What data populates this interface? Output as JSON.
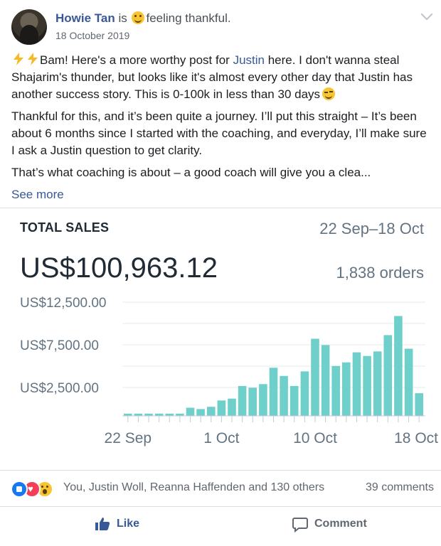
{
  "post": {
    "author": "Howie Tan",
    "status_prefix": " is ",
    "feeling": "feeling thankful.",
    "date": "18 October 2019",
    "para1_a": "Bam! Here's a more worthy post for ",
    "para1_mention": "Justin",
    "para1_b": " here. I don't wanna steal Shajarim's thunder, but looks like it's almost every other day that Justin has another success story. This is 0-100k in less than 30 days",
    "para2": "Thankful for this, and it’s been quite a journey. I’ll put this straight – It’s been about 6 months since I started with the coaching, and everyday, I’ll make sure I ask a Justin question to get clarity.",
    "para3": "That’s what coaching is about – a good coach will give you a clea...",
    "see_more": "See more"
  },
  "sales": {
    "title": "TOTAL SALES",
    "range": "22 Sep–18 Oct",
    "total": "US$100,963.12",
    "orders": "1,838 orders"
  },
  "chart_data": {
    "type": "bar",
    "ylim": [
      0,
      13000
    ],
    "yticks": [
      12500,
      7500,
      2500
    ],
    "ytick_labels": [
      "US$12,500.00",
      "US$7,500.00",
      "US$2,500.00"
    ],
    "grid_values": [
      12500,
      10000,
      7500,
      5000,
      2500
    ],
    "x_tick_labels": [
      {
        "index": 0,
        "label": "22 Sep"
      },
      {
        "index": 9,
        "label": "1 Oct"
      },
      {
        "index": 18,
        "label": "10 Oct"
      },
      {
        "index": 26,
        "label": "18 Oct"
      }
    ],
    "values": [
      250,
      250,
      250,
      250,
      250,
      250,
      900,
      750,
      1000,
      1700,
      1900,
      3300,
      3100,
      3500,
      5300,
      4400,
      3300,
      4900,
      8500,
      7800,
      5500,
      5900,
      7000,
      6600,
      7100,
      8900,
      11000,
      7400,
      2500
    ],
    "bar_color": "#6fcfcb"
  },
  "reactions": {
    "text": "You, Justin Woll, Reanna Haffenden and 130 others",
    "comments": "39 comments"
  },
  "actions": {
    "like": "Like",
    "comment": "Comment"
  },
  "colors": {
    "link": "#385898",
    "muted": "#606770",
    "like_blue": "#1877f2"
  }
}
